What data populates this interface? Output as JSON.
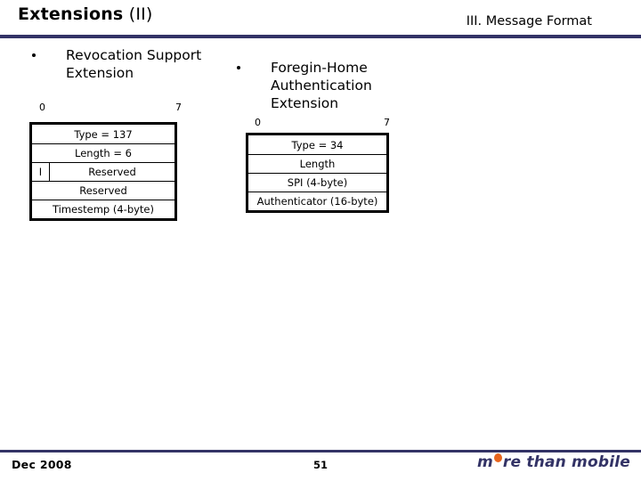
{
  "header": {
    "title_strong": "Extensions",
    "title_light": "(II)",
    "section": "III. Message Format",
    "rule_color": "#333366"
  },
  "left_block": {
    "bullet_icon": "bullet-dot-icon",
    "bullet_text": "Revocation Support\nExtension",
    "bit_start": "0",
    "bit_end": "7",
    "rows": [
      {
        "label": "Type = 137"
      },
      {
        "label": "Length = 6"
      },
      {
        "flag": "I",
        "label": "Reserved"
      },
      {
        "label": "Reserved"
      },
      {
        "label": "Timestemp (4-byte)"
      }
    ]
  },
  "right_block": {
    "bullet_icon": "bullet-dot-icon",
    "bullet_text": "Foregin-Home\nAuthentication\nExtension",
    "bit_start": "0",
    "bit_end": "7",
    "rows": [
      {
        "label": "Type = 34"
      },
      {
        "label": "Length"
      },
      {
        "label": "SPI (4-byte)"
      },
      {
        "label": "Authenticator (16-byte)"
      }
    ]
  },
  "footer": {
    "date": "Dec  2008",
    "page": "51",
    "logo_prefix": "m",
    "logo_suffix": "re than mobile",
    "logo_dot_color": "#E8661E",
    "logo_text_color": "#333366",
    "rule_color": "#333366"
  }
}
